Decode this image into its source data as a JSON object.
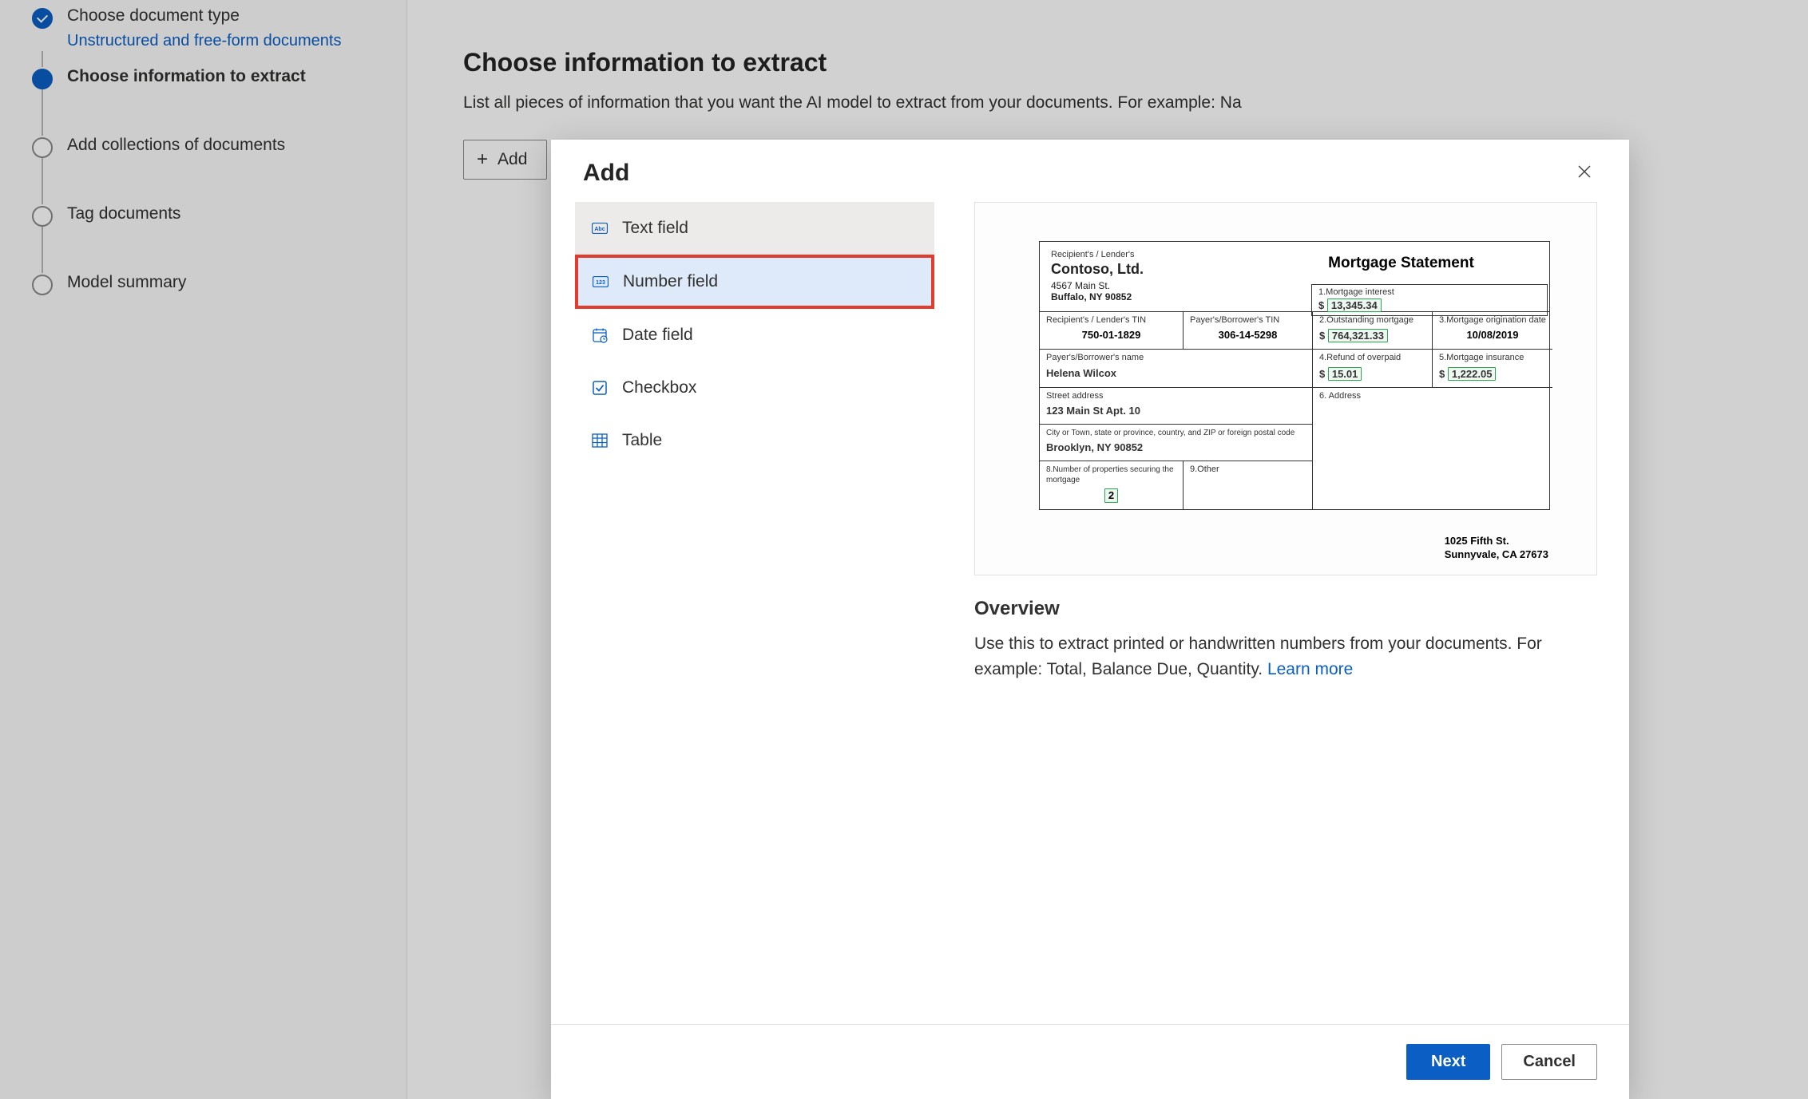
{
  "sidebar": {
    "steps": [
      {
        "title": "Choose document type",
        "sub": "Unstructured and free-form documents",
        "state": "done"
      },
      {
        "title": "Choose information to extract",
        "state": "current"
      },
      {
        "title": "Add collections of documents",
        "state": "pending"
      },
      {
        "title": "Tag documents",
        "state": "pending"
      },
      {
        "title": "Model summary",
        "state": "pending"
      }
    ]
  },
  "main": {
    "title": "Choose information to extract",
    "description": "List all pieces of information that you want the AI model to extract from your documents. For example: Na",
    "add_label": "Add"
  },
  "modal": {
    "title": "Add",
    "field_types": [
      {
        "icon": "text",
        "label": "Text field"
      },
      {
        "icon": "number",
        "label": "Number field"
      },
      {
        "icon": "date",
        "label": "Date field"
      },
      {
        "icon": "checkbox",
        "label": "Checkbox"
      },
      {
        "icon": "table",
        "label": "Table"
      }
    ],
    "overview": {
      "title": "Overview",
      "text": "Use this to extract printed or handwritten numbers from your documents. For example: Total, Balance Due, Quantity.",
      "learn_more": "Learn more"
    },
    "preview": {
      "recipient_label": "Recipient's / Lender's",
      "company": "Contoso, Ltd.",
      "addr1": "4567 Main St.",
      "addr2": "Buffalo, NY 90852",
      "doc_title": "Mortgage Statement",
      "cells": {
        "lender_tin_label": "Recipient's / Lender's TIN",
        "lender_tin": "750-01-1829",
        "payer_tin_label": "Payer's/Borrower's TIN",
        "payer_tin": "306-14-5298",
        "interest_label": "1.Mortgage interest",
        "interest_val": "13,345.34",
        "outstanding_label": "2.Outstanding mortgage",
        "outstanding_val": "764,321.33",
        "origination_label": "3.Mortgage origination date",
        "origination_val": "10/08/2019",
        "payer_name_label": "Payer's/Borrower's name",
        "payer_name": "Helena Wilcox",
        "refund_label": "4.Refund of overpaid",
        "refund_val": "15.01",
        "insurance_label": "5.Mortgage insurance",
        "insurance_val": "1,222.05",
        "street_label": "Street address",
        "street_val": "123 Main St Apt. 10",
        "address6_label": "6. Address",
        "city_label": "City or Town, state or province, country, and ZIP or foreign postal code",
        "city_val": "Brooklyn, NY 90852",
        "prop_label": "8.Number of properties securing the mortgage",
        "prop_val": "2",
        "other_label": "9.Other",
        "addr6_line1": "1025 Fifth St.",
        "addr6_line2": "Sunnyvale, CA 27673"
      }
    },
    "next_label": "Next",
    "cancel_label": "Cancel"
  }
}
